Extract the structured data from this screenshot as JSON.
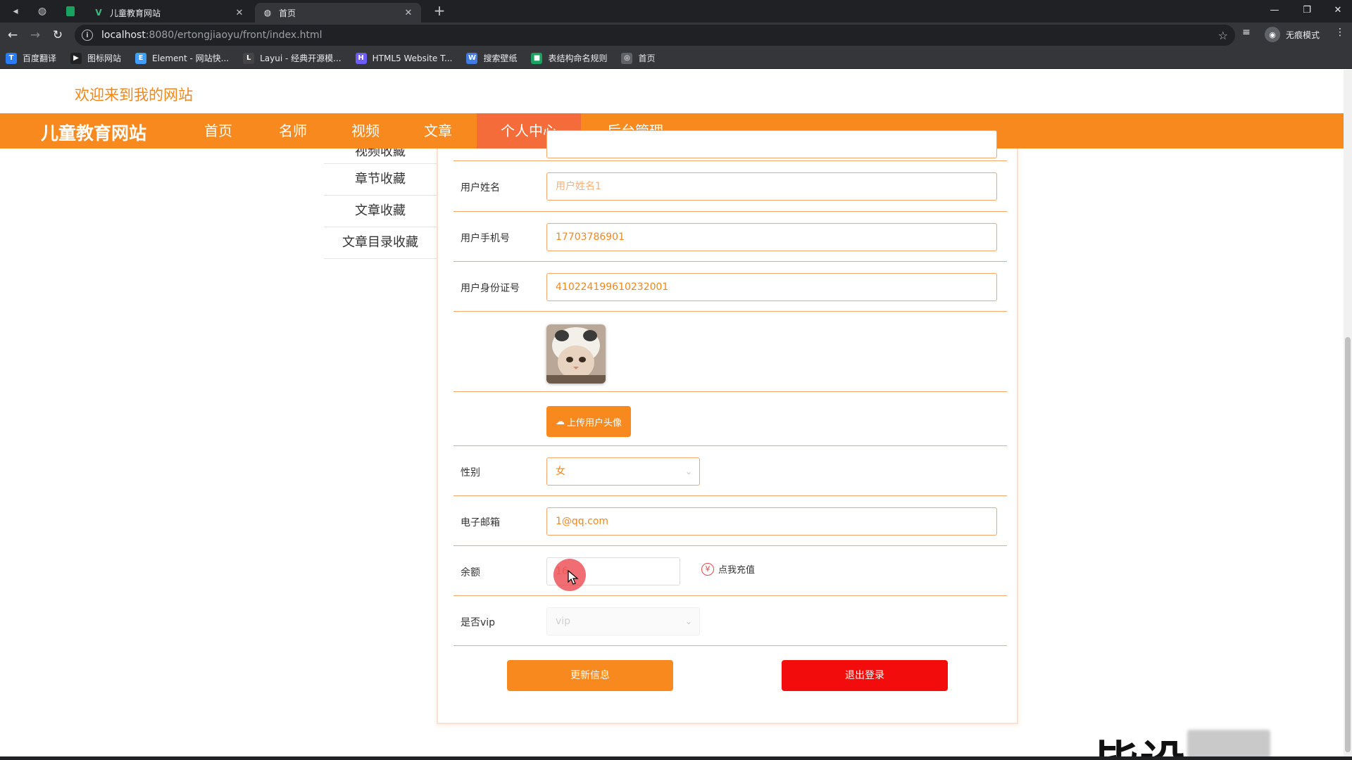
{
  "browser": {
    "tabs": [
      {
        "title": "儿童教育网站"
      },
      {
        "title": "首页"
      }
    ],
    "new_tab": "+",
    "url_host": "localhost",
    "url_path": ":8080/ertongjiaoyu/front/index.html",
    "incognito_label": "无痕模式",
    "bookmarks": [
      {
        "label": "百度翻译",
        "color": "#2a7cf6",
        "glyph": "T"
      },
      {
        "label": "图标网站",
        "color": "#222222",
        "glyph": "▶"
      },
      {
        "label": "Element - 网站快...",
        "color": "#409eff",
        "glyph": "E"
      },
      {
        "label": "Layui - 经典开源模...",
        "color": "#444444",
        "glyph": "L"
      },
      {
        "label": "HTML5 Website T...",
        "color": "#6e5cf6",
        "glyph": "H"
      },
      {
        "label": "搜索壁纸",
        "color": "#3f7be0",
        "glyph": "W"
      },
      {
        "label": "表结构命名规则",
        "color": "#1aa260",
        "glyph": "■"
      },
      {
        "label": "首页",
        "color": "#5f6368",
        "glyph": "◎"
      }
    ]
  },
  "site": {
    "welcome": "欢迎来到我的网站",
    "brand": "儿童教育网站",
    "nav": [
      "首页",
      "名师",
      "视频",
      "文章",
      "个人中心",
      "后台管理"
    ],
    "active_nav": "个人中心"
  },
  "sidebar": {
    "items": [
      "视频收藏",
      "章节收藏",
      "文章收藏",
      "文章目录收藏"
    ]
  },
  "form": {
    "name_label": "用户姓名",
    "name_placeholder": "用户姓名1",
    "phone_label": "用户手机号",
    "phone_value": "17703786901",
    "idcard_label": "用户身份证号",
    "idcard_value": "410224199610232001",
    "upload_label": "上传用户头像",
    "gender_label": "性别",
    "gender_value": "女",
    "email_label": "电子邮箱",
    "email_value": "1@qq.com",
    "balance_label": "余额",
    "balance_value": "16",
    "recharge_label": "点我充值",
    "vip_label": "是否vip",
    "vip_value": "vip",
    "update_button": "更新信息",
    "logout_button": "退出登录"
  },
  "watermark": "毕设",
  "colors": {
    "primary": "#f7891e",
    "nav_active": "#f36c3a",
    "danger": "#f20c0c"
  }
}
